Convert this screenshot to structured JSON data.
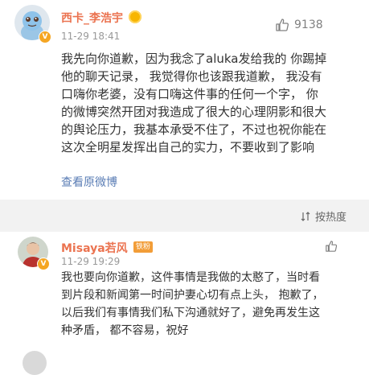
{
  "comments": [
    {
      "username": "西卡_李浩宇",
      "time": "11-29 18:41",
      "likes": "9138",
      "content_lines": [
        "我先向你道歉，因为我念了aluka发给我的 你踢掉",
        "他的聊天记录， 我觉得你也该跟我道歉， 我没有",
        "口嗨你老婆，没有口嗨这件事的任何一个字， 你",
        "的微博突然开团对我造成了很大的心理阴影和很大",
        "的舆论压力，我基本承受不住了，不过也祝你能在",
        "这次全明星发挥出自己的实力，不要收到了影响"
      ],
      "view_original": "查看原微博",
      "icons": [
        "squirtle-avatar",
        "verified-icon",
        "medal-icon",
        "thumb-up-icon"
      ]
    },
    {
      "username": "Misaya若风",
      "badge": "铁粉",
      "time": "11-29 19:29",
      "likes": "",
      "content_lines": [
        "我也要向你道歉，这件事情是我做的太憨了，当时看",
        "到片段和新闻第一时间护妻心切有点上头， 抱歉了，",
        "以后我们有事情我们私下沟通就好了，避免再发生这",
        "种矛盾， 都不容易，祝好"
      ],
      "icons": [
        "person-avatar",
        "fan-badge",
        "thumb-up-icon"
      ]
    }
  ],
  "sort": {
    "label": "按热度",
    "icon": "sort-icon"
  },
  "colors": {
    "username": "#eb7350",
    "link": "#5a7db5",
    "band": "#f2f2f2",
    "text": "#333333",
    "meta": "#999999"
  }
}
